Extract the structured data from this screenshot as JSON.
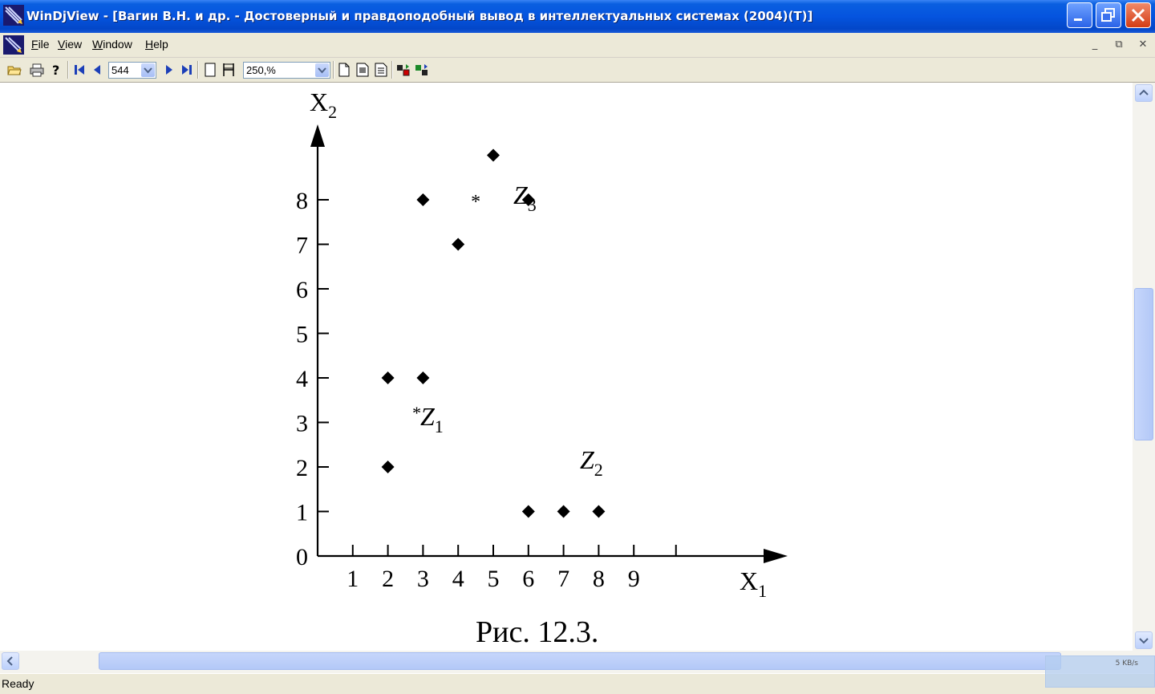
{
  "window": {
    "title": "WinDjView - [Вагин В.Н. и др. - Достоверный и правдоподобный вывод в интеллектуальных системах (2004)(T)]"
  },
  "menu": {
    "items": [
      {
        "accel": "F",
        "rest": "ile"
      },
      {
        "accel": "V",
        "rest": "iew"
      },
      {
        "accel": "W",
        "rest": "indow"
      },
      {
        "accel": "H",
        "rest": "elp"
      }
    ]
  },
  "toolbar": {
    "page_number": "544",
    "zoom": "250,%"
  },
  "status": {
    "text": "Ready",
    "net_rate": "5 KB/s"
  },
  "figure": {
    "caption": "Рис. 12.3.",
    "cluster_labels": [
      {
        "star": "*",
        "name": "Z",
        "sub": "1"
      },
      {
        "star": "",
        "name": "Z",
        "sub": "2"
      },
      {
        "star": "*",
        "name": "Z",
        "sub": "3"
      }
    ]
  },
  "chart_data": {
    "type": "scatter",
    "xlabel": "X",
    "xlabel_sub": "1",
    "ylabel": "X",
    "ylabel_sub": "2",
    "x_ticks": [
      "1",
      "2",
      "3",
      "4",
      "5",
      "6",
      "7",
      "8",
      "9"
    ],
    "y_ticks": [
      "0",
      "1",
      "2",
      "3",
      "4",
      "5",
      "6",
      "7",
      "8"
    ],
    "xlim": [
      0,
      10.5
    ],
    "ylim": [
      0,
      9.5
    ],
    "points": [
      {
        "x": 2,
        "y": 2
      },
      {
        "x": 2,
        "y": 4
      },
      {
        "x": 3,
        "y": 4
      },
      {
        "x": 3,
        "y": 8
      },
      {
        "x": 4,
        "y": 7
      },
      {
        "x": 5,
        "y": 9
      },
      {
        "x": 6,
        "y": 8
      },
      {
        "x": 6,
        "y": 1
      },
      {
        "x": 7,
        "y": 1
      },
      {
        "x": 8,
        "y": 1
      }
    ],
    "centroids": [
      {
        "label": "Z1",
        "x": 2.3,
        "y": 3
      },
      {
        "label": "Z3",
        "x": 4.5,
        "y": 8
      }
    ]
  }
}
